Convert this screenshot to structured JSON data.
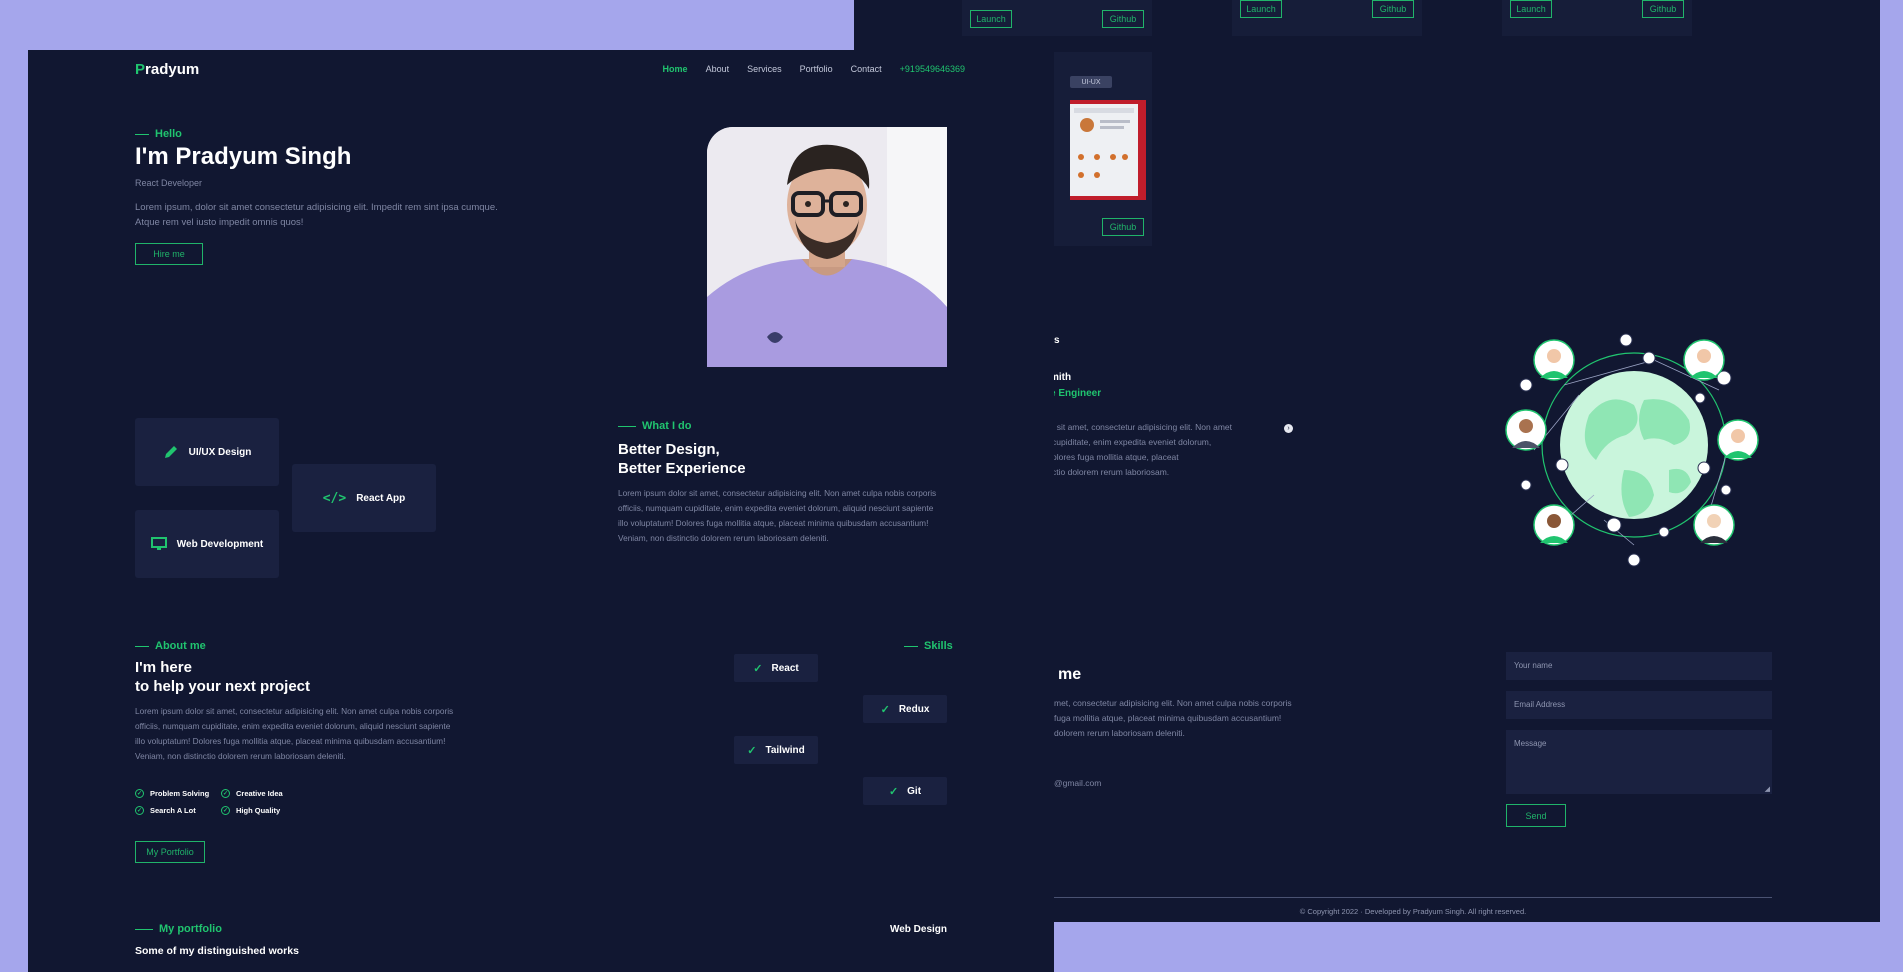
{
  "back": {
    "launch_label": "Launch",
    "github_label": "Github",
    "tag": "UI-UX",
    "testimonials": {
      "heading_fragment": "s",
      "name_fragment": "mith",
      "role_fragment": "e Engineer",
      "text_lines": [
        ". sit amet, consectetur adipisicing elit. Non amet",
        "cupiditate, enim expedita eveniet dolorum,",
        "olores fuga mollitia atque, placeat",
        "ctio dolorem rerum laboriosam."
      ]
    },
    "contact": {
      "heading_fragment": "me",
      "text_lines": [
        "met, consectetur adipisicing elit. Non amet culpa nobis corporis",
        "fuga mollitia atque, placeat minima quibusdam accusantium!",
        "dolorem rerum laboriosam deleniti."
      ],
      "email_fragment": "@gmail.com",
      "name_placeholder": "Your name",
      "email_placeholder": "Email Address",
      "message_placeholder": "Message",
      "send_label": "Send"
    },
    "footer": "© Copyright 2022 · Developed by Pradyum Singh. All right reserved."
  },
  "front": {
    "logo_first": "P",
    "logo_rest": "radyum",
    "nav": [
      "Home",
      "About",
      "Services",
      "Portfolio",
      "Contact"
    ],
    "phone": "+919549646369",
    "hero": {
      "greeting": "Hello",
      "title": "I'm Pradyum Singh",
      "role": "React Developer",
      "desc_1": "Lorem ipsum, dolor sit amet consectetur adipisicing elit. Impedit rem sint ipsa cumque.",
      "desc_2": "Atque rem vel iusto impedit omnis quos!",
      "cta": "Hire me"
    },
    "services": {
      "cards": [
        "UI/UX Design",
        "React App",
        "Web Development"
      ],
      "label": "What I do",
      "title_1": "Better Design,",
      "title_2": "Better Experience",
      "text_lines": [
        "Lorem ipsum dolor sit amet, consectetur adipisicing elit. Non amet culpa nobis corporis",
        "officiis, numquam cupiditate, enim expedita eveniet dolorum, aliquid nesciunt sapiente",
        "illo voluptatum! Dolores fuga mollitia atque, placeat minima quibusdam accusantium!",
        "Veniam, non distinctio dolorem rerum laboriosam deleniti."
      ]
    },
    "about": {
      "label": "About me",
      "title_1": "I'm here",
      "title_2": "to help your next project",
      "text_lines": [
        "Lorem ipsum dolor sit amet, consectetur adipisicing elit. Non amet culpa nobis corporis",
        "officiis, numquam cupiditate, enim expedita eveniet dolorum, aliquid nesciunt sapiente",
        "illo voluptatum! Dolores fuga mollitia atque, placeat minima quibusdam accusantium!",
        "Veniam, non distinctio dolorem rerum laboriosam deleniti."
      ],
      "features": [
        "Problem Solving",
        "Creative Idea",
        "Search A Lot",
        "High Quality"
      ],
      "cta": "My Portfolio"
    },
    "skills": {
      "label": "Skills",
      "items": [
        "React",
        "Redux",
        "Tailwind",
        "Git"
      ]
    },
    "portfolio": {
      "label": "My portfolio",
      "subtitle": "Some of my distinguished works",
      "filter": "Web Design"
    }
  },
  "colors": {
    "background": "#a5a6ec",
    "panel": "#111731",
    "card": "#1a2140",
    "accent": "#20c46f"
  },
  "icons": {
    "uiux": "pencil-icon",
    "react": "code-icon",
    "web": "monitor-icon",
    "skill": "check-icon",
    "feature": "check-circle-icon",
    "slider": "arrow-right-circle-icon"
  }
}
